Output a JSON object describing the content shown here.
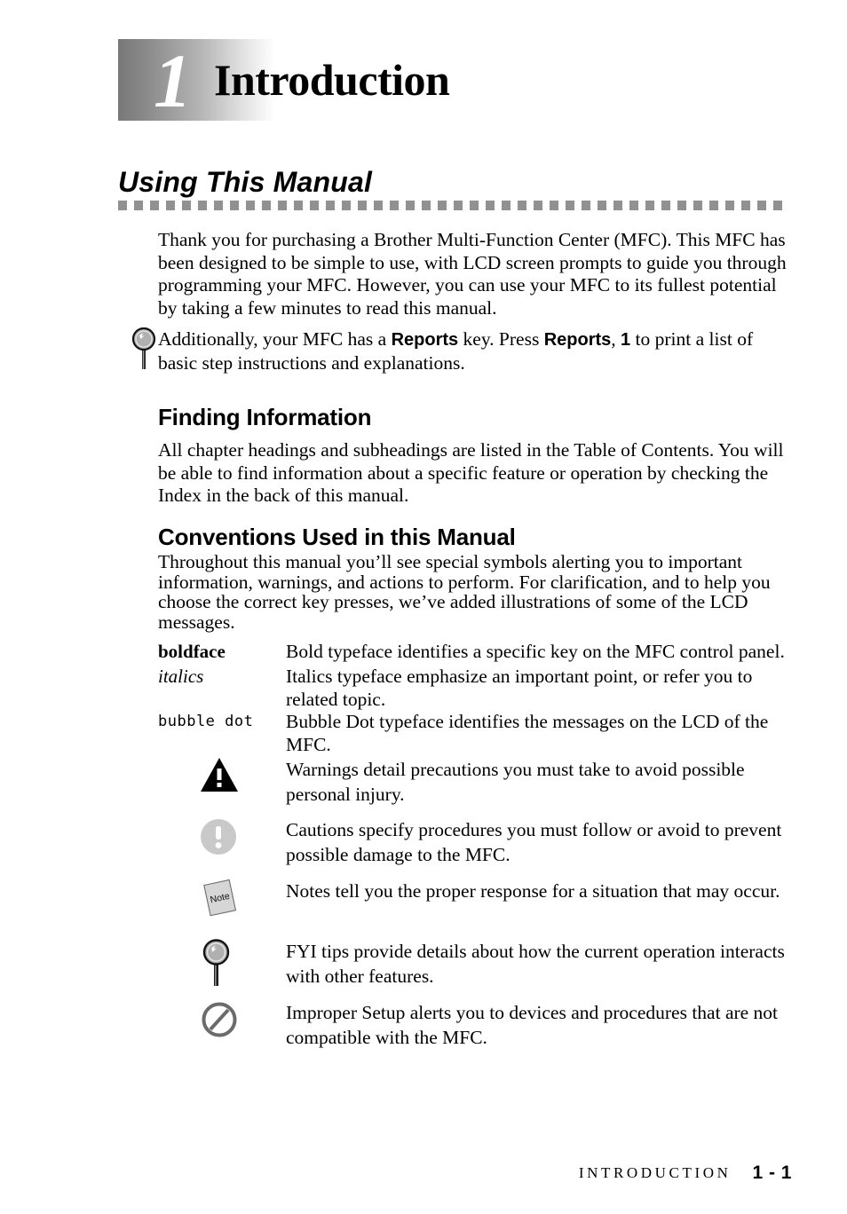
{
  "document": {
    "chapter_number": "1",
    "chapter_title": "Introduction"
  },
  "section": {
    "heading": "Using This Manual",
    "intro_paragraph": "Thank you for purchasing a Brother Multi-Function Center (MFC). This MFC has been designed to be simple to use, with LCD screen prompts to guide you through programming your MFC. However, you can use your MFC to its fullest potential by taking a few minutes to read this manual."
  },
  "fyi_callout": {
    "icon": "magnifier-icon",
    "text_part_1": "Additionally, your MFC has a ",
    "key_1": "Reports",
    "text_part_2": " key. Press ",
    "key_2": "Reports",
    "text_part_3": ", ",
    "key_3": "1",
    "text_part_4": " to print a list of basic step instructions and explanations."
  },
  "finding_information": {
    "heading": "Finding Information",
    "paragraph": "All chapter headings and subheadings are listed in the Table of Contents. You will be able to find information about a specific feature or operation by checking the Index in the back of this manual."
  },
  "conventions": {
    "heading": "Conventions Used in this Manual",
    "paragraph": "Throughout this manual you’ll see special symbols alerting you to important information, warnings, and actions to perform. For clarification, and to help you choose the correct key presses, we’ve added illustrations of some of the LCD messages.",
    "typefaces": [
      {
        "term": "boldface",
        "style": "bold",
        "description": "Bold typeface identifies a specific key on the MFC control panel."
      },
      {
        "term": "italics",
        "style": "italic",
        "description": "Italics typeface emphasize an important point, or refer you to related topic."
      },
      {
        "term": "bubble dot",
        "style": "mono",
        "description": "Bubble Dot typeface identifies the messages on the LCD of the MFC."
      }
    ],
    "symbols": [
      {
        "icon": "warning-triangle-icon",
        "description": "Warnings detail precautions you must take to avoid possible personal injury."
      },
      {
        "icon": "caution-circle-icon",
        "description": "Cautions specify procedures you must follow or avoid to prevent possible damage to the MFC."
      },
      {
        "icon": "note-paper-icon",
        "icon_label": "Note",
        "description": "Notes tell you the proper response for a situation that may occur."
      },
      {
        "icon": "magnifier-icon",
        "description": "FYI tips provide details about how the current operation interacts with other features."
      },
      {
        "icon": "prohibition-circle-icon",
        "description": "Improper Setup alerts you to devices and procedures that are not compatible with the MFC."
      }
    ]
  },
  "footer": {
    "label": "INTRODUCTION",
    "page": "1 - 1"
  },
  "colors": {
    "rule_gray": "#919191",
    "caution_gray": "#c9c9c9",
    "note_gray": "#d4d4d4",
    "prohibition_gray": "#6b6b6b",
    "magnifier_gray": "#b0b0b0"
  }
}
